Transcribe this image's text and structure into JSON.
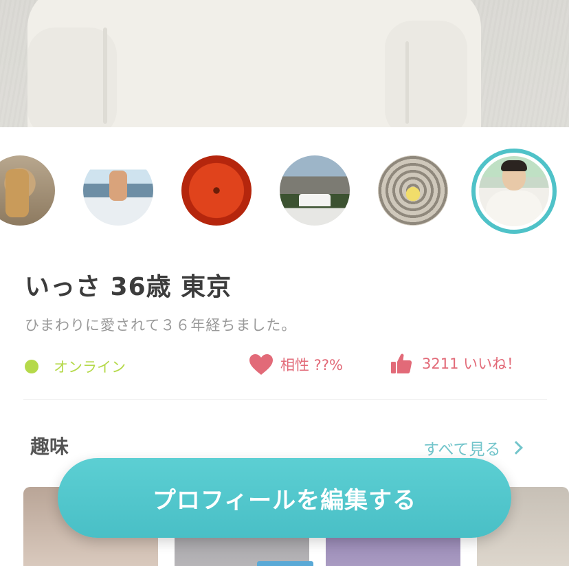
{
  "profile": {
    "title": "いっさ 36歳 東京",
    "bio": "ひまわりに愛されて３６年経ちました。",
    "status": "オンライン",
    "compatibility": "相性 ??%",
    "likes": "3211 いいね！"
  },
  "photos": {
    "count_visible": 6,
    "selected_index": 5
  },
  "hobbies": {
    "heading": "趣味",
    "see_all": "すべて見る"
  },
  "cta": {
    "label": "プロフィールを編集する"
  },
  "colors": {
    "accent": "#4fc2c8",
    "online": "#b5d94a",
    "like": "#e26a78",
    "muted_text": "#9a9a9a"
  },
  "icons": {
    "online": "online-dot-icon",
    "compatibility": "heart-icon",
    "likes": "thumbs-up-icon",
    "see_all": "chevron-right-icon"
  }
}
